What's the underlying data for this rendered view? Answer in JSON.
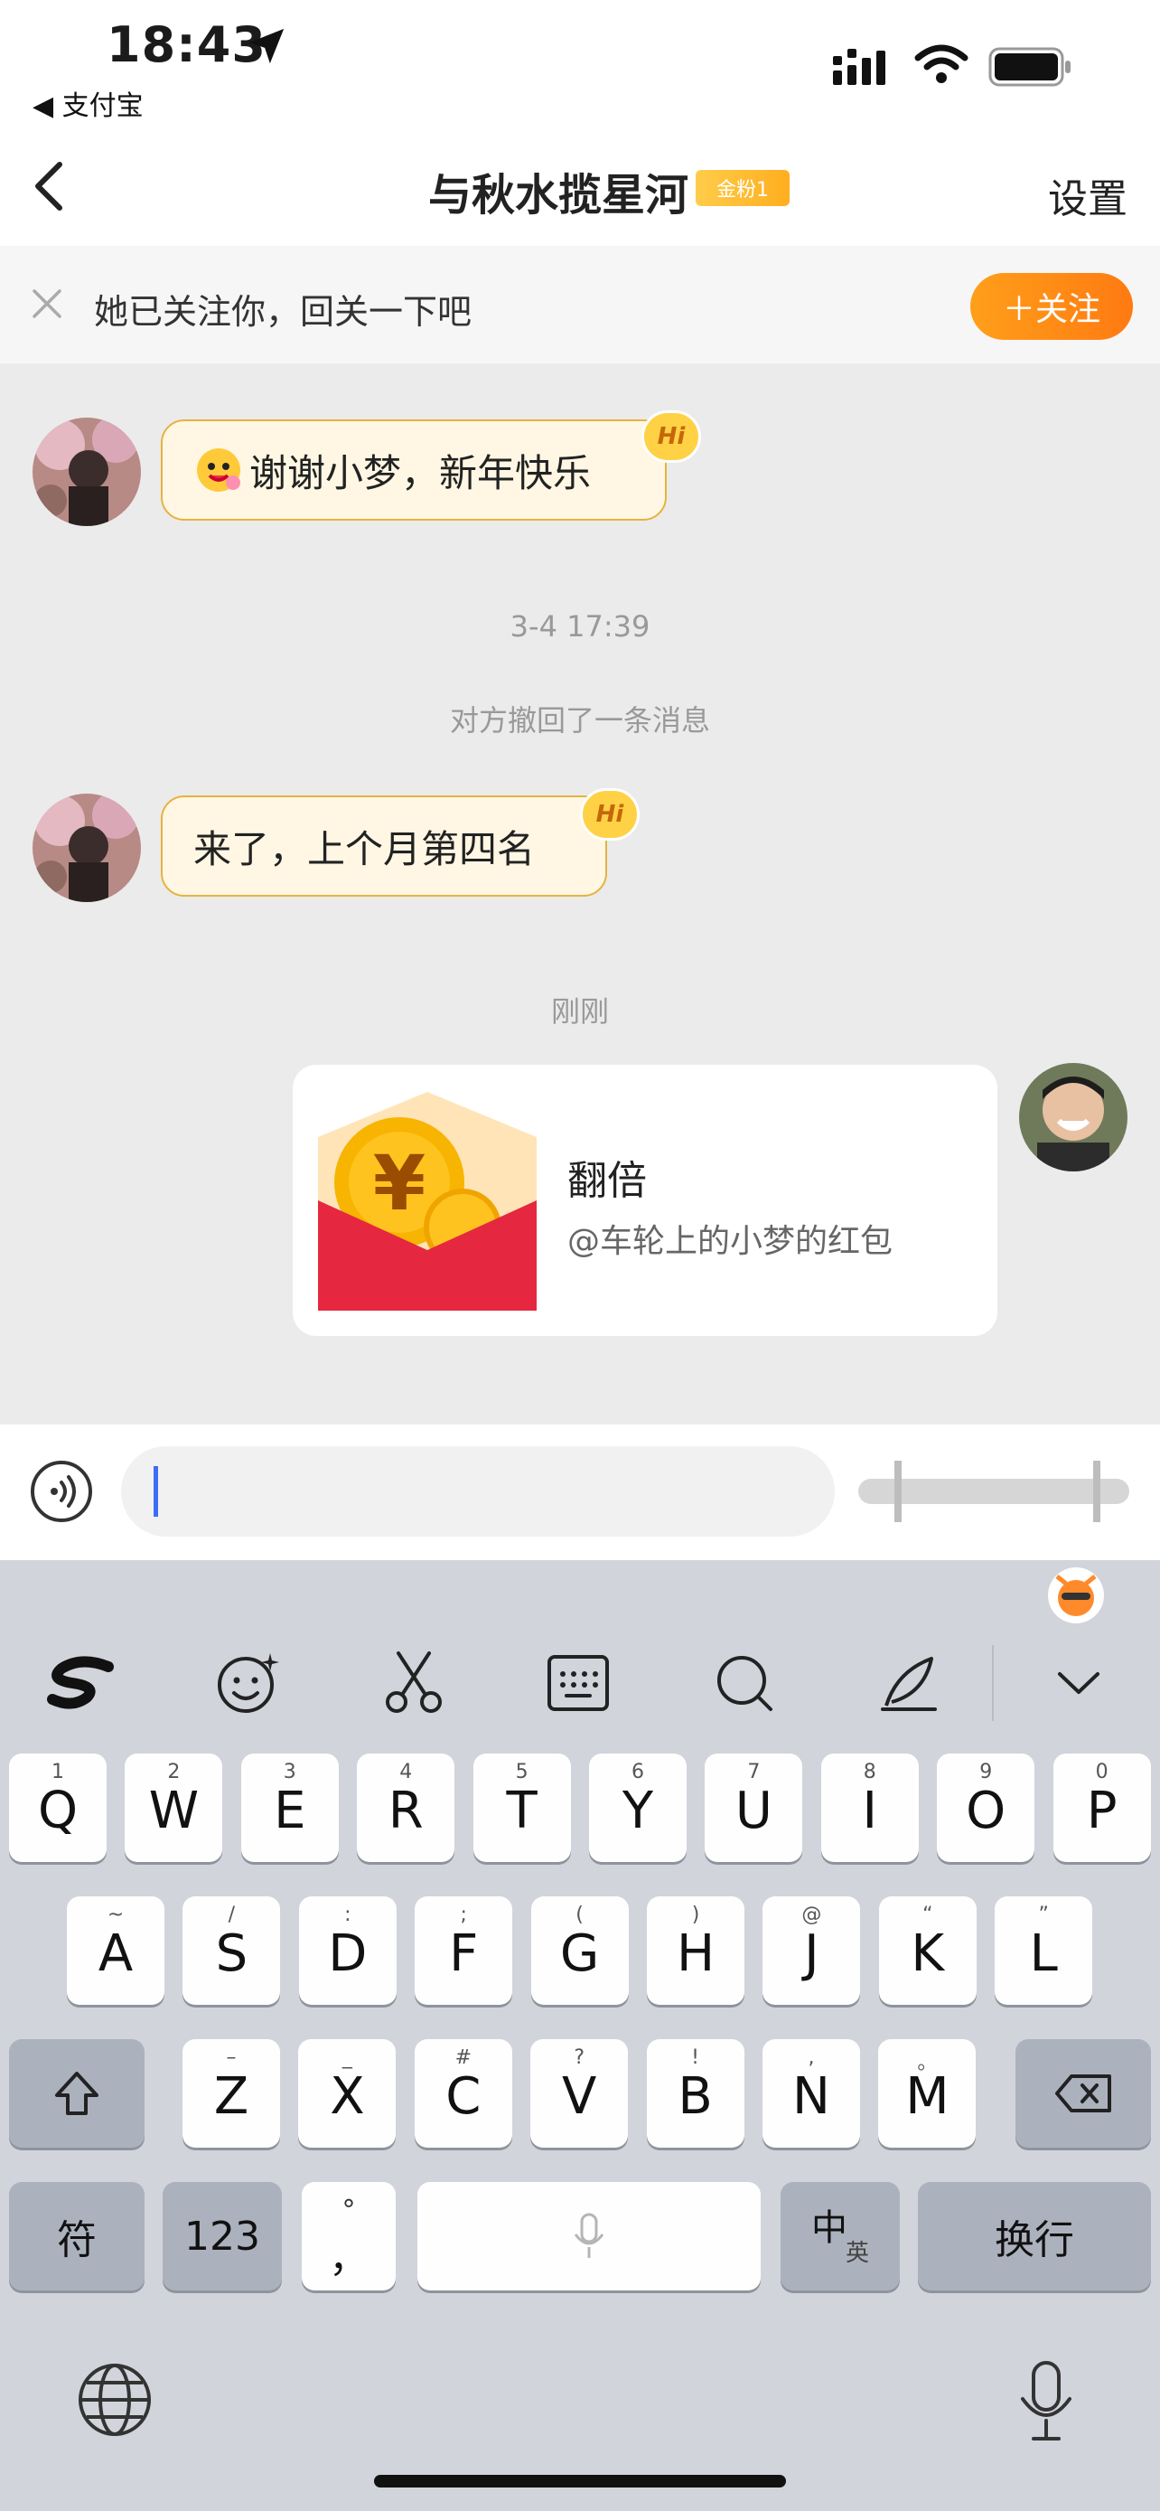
{
  "status_bar": {
    "time": "18:43",
    "back_app": "◀ 支付宝"
  },
  "header": {
    "title": "与秋水揽星河丶",
    "badge": "金粉1",
    "settings": "设置"
  },
  "follow_banner": {
    "text": "她已关注你，回关一下吧",
    "button": "＋关注"
  },
  "messages": {
    "msg1": {
      "text": "谢谢小梦，新年快乐",
      "hi": "Hi"
    },
    "timestamp": "3-4 17:39",
    "recalled": "对方撤回了一条消息",
    "msg2": {
      "text": "来了，上个月第四名",
      "hi": "Hi"
    },
    "just_now": "刚刚",
    "red_packet": {
      "title": "翻倍",
      "subtitle": "@车轮上的小梦的红包"
    }
  },
  "keyboard": {
    "row1": [
      {
        "hint": "1",
        "key": "Q"
      },
      {
        "hint": "2",
        "key": "W"
      },
      {
        "hint": "3",
        "key": "E"
      },
      {
        "hint": "4",
        "key": "R"
      },
      {
        "hint": "5",
        "key": "T"
      },
      {
        "hint": "6",
        "key": "Y"
      },
      {
        "hint": "7",
        "key": "U"
      },
      {
        "hint": "8",
        "key": "I"
      },
      {
        "hint": "9",
        "key": "O"
      },
      {
        "hint": "0",
        "key": "P"
      }
    ],
    "row2": [
      {
        "hint": "~",
        "key": "A"
      },
      {
        "hint": "/",
        "key": "S"
      },
      {
        "hint": ":",
        "key": "D"
      },
      {
        "hint": ";",
        "key": "F"
      },
      {
        "hint": "(",
        "key": "G"
      },
      {
        "hint": ")",
        "key": "H"
      },
      {
        "hint": "@",
        "key": "J"
      },
      {
        "hint": "“",
        "key": "K"
      },
      {
        "hint": "”",
        "key": "L"
      }
    ],
    "row3": [
      {
        "hint": "–",
        "key": "Z"
      },
      {
        "hint": "_",
        "key": "X"
      },
      {
        "hint": "#",
        "key": "C"
      },
      {
        "hint": "?",
        "key": "V"
      },
      {
        "hint": "!",
        "key": "B"
      },
      {
        "hint": ",",
        "key": "N"
      },
      {
        "hint": "。",
        "key": "M"
      }
    ],
    "symbols": "符",
    "numbers": "123",
    "punct_top": "°",
    "punct_bottom": "，",
    "lang_zh": "中",
    "lang_en": "英",
    "enter": "换行"
  },
  "colors": {
    "accent_orange": "#ff8a14",
    "bubble_border": "#e6b240",
    "cursor": "#3b6df6"
  }
}
